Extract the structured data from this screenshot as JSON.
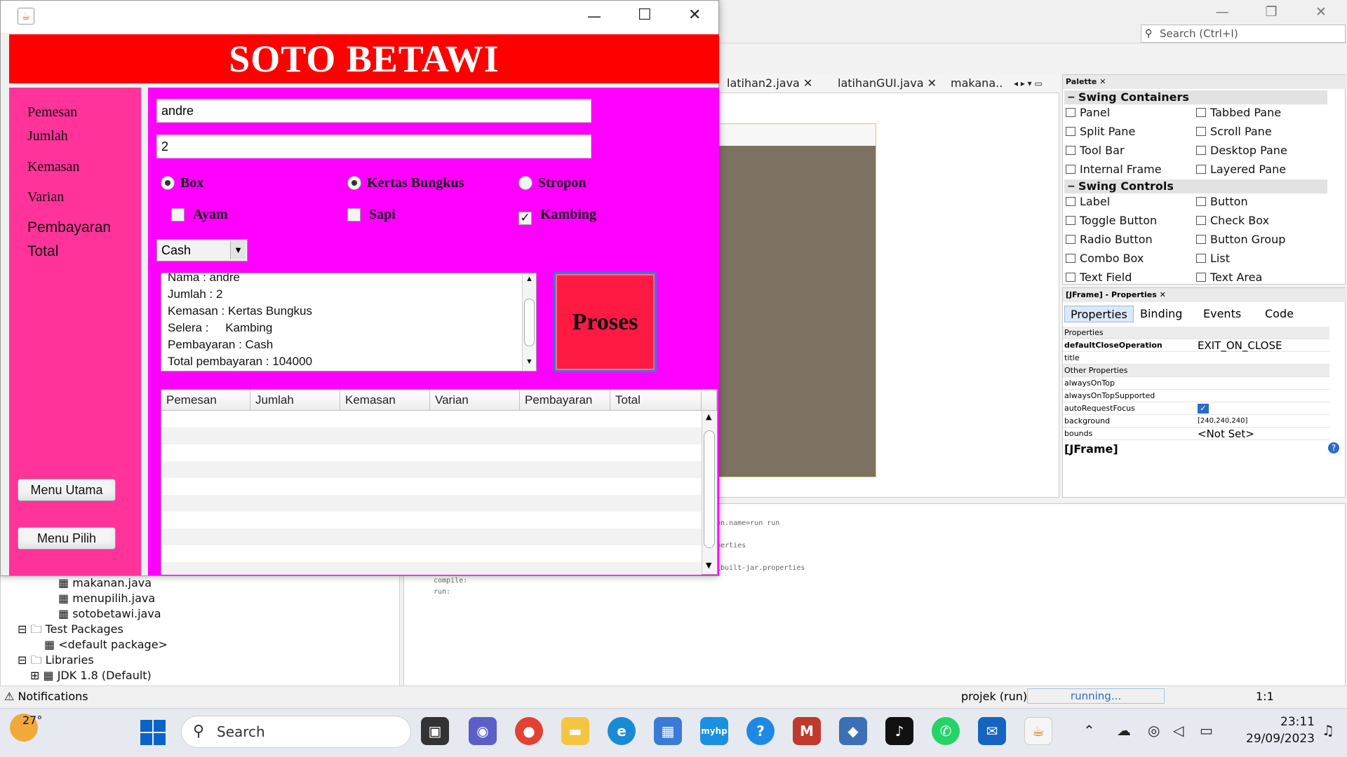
{
  "app": {
    "header_title": "SOTO BETAWI",
    "labels": {
      "pemesan": "Pemesan",
      "jumlah": "Jumlah",
      "kemasan": "Kemasan",
      "varian": "Varian",
      "pembayaran": "Pembayaran",
      "total": "Total"
    },
    "fields": {
      "pemesan_value": "andre",
      "jumlah_value": "2"
    },
    "kemasan_options": [
      {
        "label": "Box",
        "selected": false
      },
      {
        "label": "Kertas Bungkus",
        "selected": true
      },
      {
        "label": "Stropon",
        "selected": false
      }
    ],
    "varian_options": [
      {
        "label": "Ayam",
        "checked": false
      },
      {
        "label": "Sapi",
        "checked": false
      },
      {
        "label": "Kambing",
        "checked": true
      }
    ],
    "payment_selected": "Cash",
    "summary_lines": [
      "Nama : andre",
      "Jumlah : 2",
      "Kemasan : Kertas Bungkus",
      "Selera :     Kambing",
      "Pembayaran : Cash",
      "Total pembayaran : 104000"
    ],
    "proses_button": "Proses",
    "menu_utama_button": "Menu Utama",
    "menu_pilih_button": "Menu Pilih",
    "table_columns": [
      "Pemesan",
      "Jumlah",
      "Kemasan",
      "Varian",
      "Pembayaran",
      "Total"
    ]
  },
  "ide": {
    "search_placeholder": "Search (Ctrl+I)",
    "editor_tabs": [
      "latihan2.java",
      "latihanGUI.java",
      "makana.."
    ],
    "palette_title": "Palette",
    "palette_sections": [
      {
        "title": "Swing Containers",
        "items": [
          "Panel",
          "Tabbed Pane",
          "Split Pane",
          "Scroll Pane",
          "Tool Bar",
          "Desktop Pane",
          "Internal Frame",
          "Layered Pane"
        ]
      },
      {
        "title": "Swing Controls",
        "items": [
          "Label",
          "Button",
          "Toggle Button",
          "Check Box",
          "Radio Button",
          "Button Group",
          "Combo Box",
          "List",
          "Text Field",
          "Text Area"
        ]
      }
    ],
    "properties_title": "[JFrame] - Properties",
    "properties_tabs": [
      "Properties",
      "Binding",
      "Events",
      "Code"
    ],
    "properties_group": "Properties",
    "other_properties_group": "Other Properties",
    "properties_rows": [
      {
        "key": "defaultCloseOperation",
        "value": "EXIT_ON_CLOSE"
      },
      {
        "key": "title",
        "value": ""
      },
      {
        "key": "alwaysOnTop",
        "value": ""
      },
      {
        "key": "alwaysOnTopSupported",
        "value": ""
      },
      {
        "key": "autoRequestFocus",
        "value": ""
      },
      {
        "key": "background",
        "value": "[240,240,240]"
      },
      {
        "key": "bounds",
        "value": "<Not Set>"
      }
    ],
    "description_title": "[JFrame]",
    "console_lines": [
      "on.name=run run",
      "perties",
      "\\built-jar.properties",
      "compile:",
      "run:"
    ],
    "tree_items": [
      "makanan.java",
      "menupilih.java",
      "sotobetawi.java",
      "Test Packages",
      "<default package>",
      "Libraries",
      "JDK 1.8 (Default)"
    ],
    "notifications": "Notifications",
    "status_project": "projek (run)",
    "status_running": "running...",
    "status_position": "1:1"
  },
  "taskbar": {
    "weather_temp": "27°",
    "search_label": "Search",
    "time": "23:11",
    "date": "29/09/2023",
    "colors": {
      "accent": "#0a64c8"
    }
  }
}
